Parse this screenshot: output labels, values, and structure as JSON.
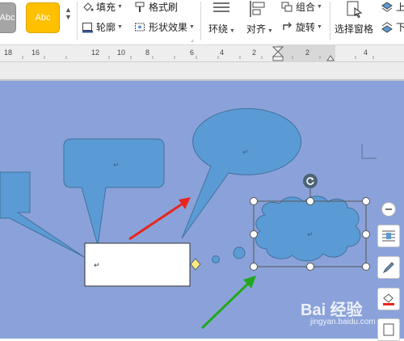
{
  "ribbon": {
    "style_swatch_1": "Abc",
    "style_swatch_2": "Abc",
    "fill_label": "填充",
    "format_painter_label": "格式刷",
    "outline_label": "轮廓",
    "shape_effects_label": "形状效果",
    "wrap_label": "环绕",
    "align_label": "对齐",
    "group_label": "组合",
    "rotate_label": "旋转",
    "selection_pane_label": "选择窗格",
    "move_label": "上",
    "move_down_label": "下"
  },
  "ruler": {
    "ticks": [
      "18",
      "16",
      "12",
      "10",
      "8",
      "6",
      "4",
      "2",
      "2",
      "4"
    ]
  },
  "canvas": {
    "paragraph_mark": "↵"
  },
  "watermark": {
    "text": "Bai 经验",
    "url": "jingyan.baidu.com"
  },
  "colors": {
    "canvas_bg": "#8aa2d9",
    "shape_fill": "#5b9bd5",
    "shape_stroke": "#41719c",
    "arrow_red": "#e8261e",
    "arrow_green": "#22a81e",
    "swatch_orange": "#ffc000",
    "swatch_gray": "#a5a5a5"
  }
}
